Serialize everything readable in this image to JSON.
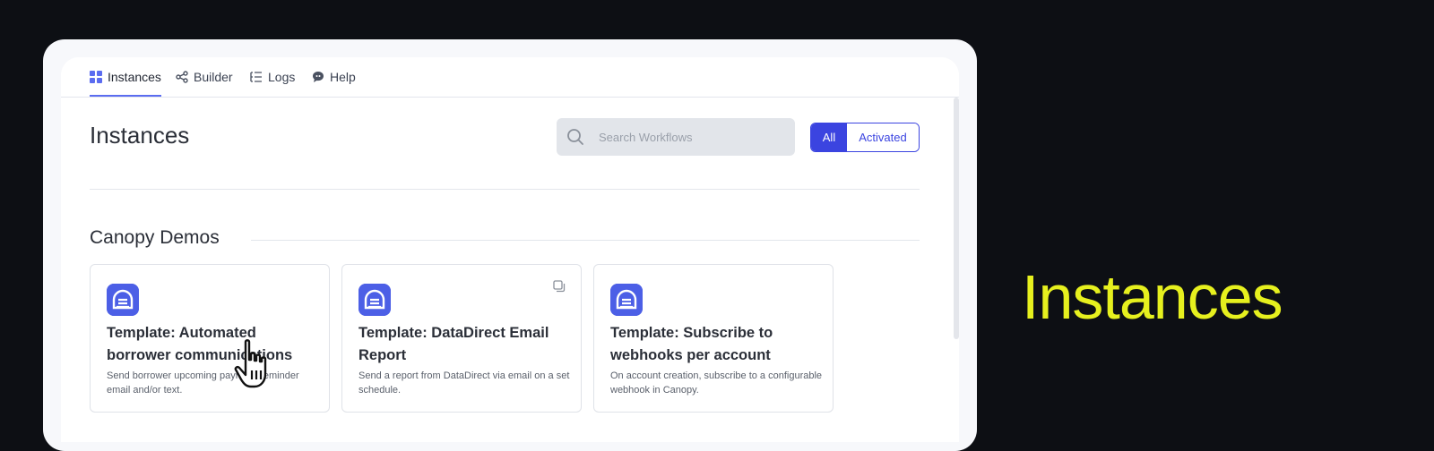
{
  "nav": {
    "items": [
      {
        "label": "Instances",
        "icon": "grid-icon",
        "active": true
      },
      {
        "label": "Builder",
        "icon": "share-icon",
        "active": false
      },
      {
        "label": "Logs",
        "icon": "list-icon",
        "active": false
      },
      {
        "label": "Help",
        "icon": "chat-bubble-icon",
        "active": false
      }
    ]
  },
  "page": {
    "title": "Instances"
  },
  "search": {
    "placeholder": "Search Workflows",
    "value": ""
  },
  "filter": {
    "all_label": "All",
    "activated_label": "Activated",
    "selected": "All"
  },
  "group": {
    "title": "Canopy Demos",
    "cards": [
      {
        "title": "Template: Automated borrower communications",
        "description": "Send borrower upcoming payment reminder email and/or text."
      },
      {
        "title": "Template: DataDirect Email Report",
        "description": "Send a report from DataDirect via email on a set schedule."
      },
      {
        "title": "Template: Subscribe to webhooks per account",
        "description": "On account creation, subscribe to a configurable webhook in Canopy."
      }
    ]
  },
  "side_caption": "Instances",
  "colors": {
    "accent": "#3b44e0",
    "logo": "#4c5fe6",
    "caption": "#e6f01e",
    "background": "#0d0f14"
  }
}
